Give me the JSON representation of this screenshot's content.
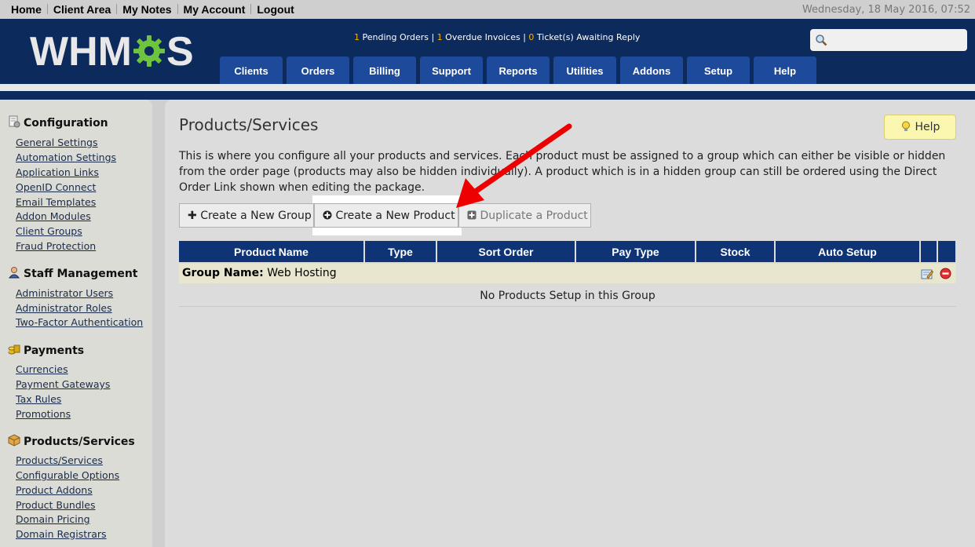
{
  "topnav": {
    "items": [
      "Home",
      "Client Area",
      "My Notes",
      "My Account",
      "Logout"
    ],
    "datetime": "Wednesday, 18 May 2016, 07:52"
  },
  "header": {
    "logo_text_left": "WHM",
    "logo_text_right": "S",
    "stats": {
      "pending_count": "1",
      "pending_label": "Pending Orders |",
      "overdue_count": "1",
      "overdue_label": "Overdue Invoices |",
      "tickets_count": "0",
      "tickets_label": "Ticket(s) Awaiting Reply"
    },
    "search_placeholder": "",
    "tabs": [
      "Clients",
      "Orders",
      "Billing",
      "Support",
      "Reports",
      "Utilities",
      "Addons",
      "Setup",
      "Help"
    ]
  },
  "sidebar": {
    "sections": [
      {
        "title": "Configuration",
        "icon": "configuration-icon",
        "links": [
          "General Settings",
          "Automation Settings",
          "Application Links",
          "OpenID Connect",
          "Email Templates",
          "Addon Modules",
          "Client Groups",
          "Fraud Protection"
        ]
      },
      {
        "title": "Staff Management",
        "icon": "staff-icon",
        "links": [
          "Administrator Users",
          "Administrator Roles",
          "Two-Factor Authentication"
        ]
      },
      {
        "title": "Payments",
        "icon": "payments-icon",
        "links": [
          "Currencies",
          "Payment Gateways",
          "Tax Rules",
          "Promotions"
        ]
      },
      {
        "title": "Products/Services",
        "icon": "products-icon",
        "links": [
          "Products/Services",
          "Configurable Options",
          "Product Addons",
          "Product Bundles",
          "Domain Pricing",
          "Domain Registrars"
        ]
      }
    ]
  },
  "main": {
    "title": "Products/Services",
    "help_label": "Help",
    "description": "This is where you configure all your products and services. Each product must be assigned to a group which can either be visible or hidden from the order page (products may also be hidden individually). A product which is in a hidden group can still be ordered using the Direct Order Link shown when editing the package.",
    "buttons": {
      "create_group": "Create a New Group",
      "create_product": "Create a New Product",
      "duplicate_product": "Duplicate a Product"
    },
    "table": {
      "columns": [
        "Product Name",
        "Type",
        "Sort Order",
        "Pay Type",
        "Stock",
        "Auto Setup",
        "",
        ""
      ],
      "group_label": "Group Name:",
      "group_name": "Web Hosting",
      "empty_message": "No Products Setup in this Group"
    }
  },
  "colors": {
    "header_bg": "#0c2a5b",
    "tab_bg": "#1d4a9a",
    "table_header": "#0f3475",
    "group_row": "#e8e6cf",
    "arrow": "#ee0000",
    "accent_number": "#f7b400"
  }
}
